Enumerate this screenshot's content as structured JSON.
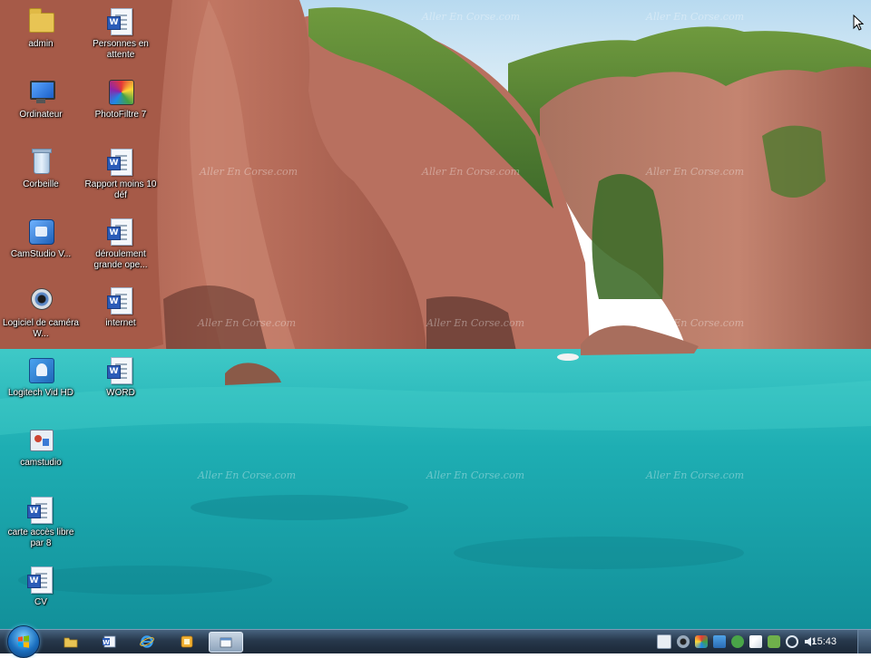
{
  "desktop": {
    "icons": [
      {
        "label": "admin",
        "icon": "user-folder-icon"
      },
      {
        "label": "Personnes en attente",
        "icon": "word-document-icon"
      },
      {
        "label": "Ordinateur",
        "icon": "computer-icon"
      },
      {
        "label": "PhotoFiltre 7",
        "icon": "photofiltre-icon"
      },
      {
        "label": "Corbeille",
        "icon": "recycle-bin-icon"
      },
      {
        "label": "Rapport moins 10 déf",
        "icon": "word-document-icon"
      },
      {
        "label": "CamStudio V...",
        "icon": "camstudio-icon"
      },
      {
        "label": "déroulement grande ope...",
        "icon": "word-document-icon"
      },
      {
        "label": "Logiciel de caméra W...",
        "icon": "webcam-software-icon"
      },
      {
        "label": "internet",
        "icon": "word-document-icon"
      },
      {
        "label": "Logitech Vid HD",
        "icon": "logitech-vid-icon"
      },
      {
        "label": "WORD",
        "icon": "word-document-icon"
      },
      {
        "label": "camstudio",
        "icon": "camstudio-shortcut-icon"
      },
      {
        "label": "carte accès libre par 8",
        "icon": "word-document-icon"
      },
      {
        "label": "CV",
        "icon": "word-document-icon"
      }
    ],
    "watermark": "Aller En Corse.com"
  },
  "taskbar": {
    "pinned": [
      {
        "name": "explorer",
        "icon": "folder-icon"
      },
      {
        "name": "word",
        "icon": "word-icon"
      },
      {
        "name": "internet-explorer",
        "icon": "ie-icon"
      },
      {
        "name": "app",
        "icon": "app-icon"
      },
      {
        "name": "camstudio-window",
        "icon": "window-icon",
        "active": true
      }
    ],
    "clock": "15:43"
  },
  "colors": {
    "sea": "#1fb2b6",
    "rock": "#b5685a",
    "vegetation": "#4f7a2f",
    "sky": "#cfe6f5",
    "taskbar": "#27384c"
  }
}
